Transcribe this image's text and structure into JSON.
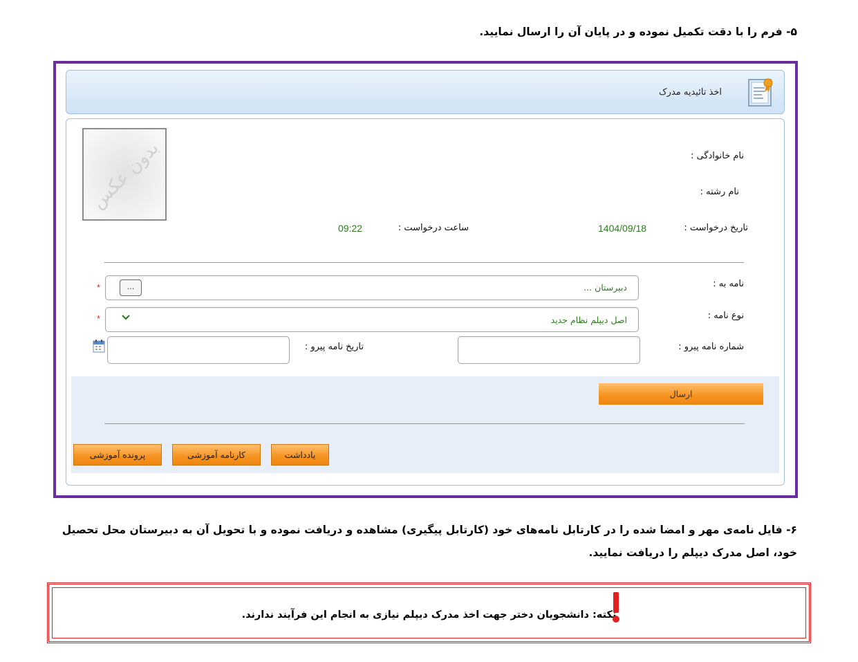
{
  "instructions": {
    "step5": "۵- فرم را با دقت تکمیل نموده و در پایان آن را ارسال نمایید.",
    "step6": "۶- فایل نامه‌ی مهر و امضا شده را در کارتابل نامه‌های خود (کارتابل پیگیری) مشاهده و دریافت نموده و با تحویل آن به دبیرستان محل تحصیل خود، اصل مدرک دیپلم را دریافت نمایید."
  },
  "form": {
    "header_title": "اخذ تائیدیه مدرک",
    "photo_placeholder": "بدون عکس",
    "labels": {
      "family_name": "نام خانوادگی :",
      "major": "نام رشته :",
      "request_date": "تاریخ درخواست :",
      "request_time": "ساعت درخواست :",
      "letter_to": "نامه به :",
      "letter_type": "نوع نامه :",
      "follow_number": "شماره نامه پیرو :",
      "follow_date": "تاریخ نامه پیرو :"
    },
    "values": {
      "request_date": "1404/09/18",
      "request_time": "09:22",
      "letter_to": "دبیرستان ...",
      "letter_type": "اصل دیپلم نظام جدید",
      "follow_number": "",
      "follow_date": ""
    },
    "dots_button": "...",
    "required_mark": "*",
    "send_button": "ارسال",
    "bottom_buttons": [
      "یادداشت",
      "کارنامه آموزشی",
      "پرونده آموزشی"
    ]
  },
  "note": {
    "text": "نکته: دانشجویان دختر جهت اخذ مدرک دیپلم نیازی به انجام این فرآیند ندارند."
  },
  "colors": {
    "frame_border": "#6a2ea0",
    "button_orange": "#f5921e",
    "value_green": "#2e7d1f",
    "note_red": "#e02020"
  },
  "icons": [
    "certificate-icon",
    "calendar-icon",
    "chevron-down-icon",
    "exclamation-icon"
  ]
}
